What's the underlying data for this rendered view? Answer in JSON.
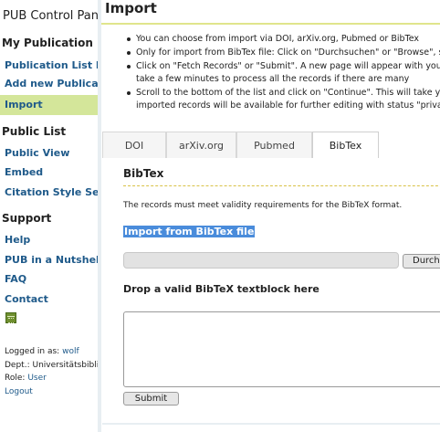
{
  "app": {
    "title": "PUB Control Panel"
  },
  "sidebar": {
    "section_my": "My Publication List",
    "my_items": [
      {
        "label": "Publication List Management"
      },
      {
        "label": "Add new Publication"
      },
      {
        "label": "Import",
        "active": true
      }
    ],
    "section_public": "Public List",
    "public_items": [
      {
        "label": "Public View"
      },
      {
        "label": "Embed"
      },
      {
        "label": "Citation Style Settings"
      }
    ],
    "section_support": "Support",
    "support_items": [
      {
        "label": "Help"
      },
      {
        "label": "PUB in a Nutshell"
      },
      {
        "label": "FAQ"
      },
      {
        "label": "Contact"
      }
    ],
    "calendar_icon": "calendar-icon",
    "user": {
      "logged_in_label": "Logged in as:",
      "logged_in_value": "wolf",
      "dept_label": "Dept.:",
      "dept_value": "Universitätsbibliothek",
      "role_label": "Role:",
      "role_value": "User",
      "logout": "Logout"
    }
  },
  "main": {
    "title": "Import",
    "bullets": [
      [
        "You can choose from import via DOI, arXiv.org, Pubmed or BibTex"
      ],
      [
        "Only for import from BibTex file: Click on \"Durchsuchen\" or \"Browse\", select your file"
      ],
      [
        "Click on \"Fetch Records\" or \"Submit\". A new page will appear with your records.",
        "take a few minutes to process all the records if there are many"
      ],
      [
        "Scroll to the bottom of the list and click on \"Continue\". This will take you to",
        "imported records will be available for further editing with status \"private\""
      ]
    ],
    "tabs": [
      "DOI",
      "arXiv.org",
      "Pubmed",
      "BibTex"
    ],
    "active_tab": "BibTex",
    "panel": {
      "title": "BibTex",
      "requirement_text": "The records must meet validity requirements for the BibTeX format.",
      "import_heading": "Import from BibTex file",
      "browse_label": "Durchsuchen...",
      "drop_heading": "Drop a valid BibTeX textblock here",
      "submit_label": "Submit"
    }
  },
  "colors": {
    "active_nav_bg": "#d4e69a",
    "link": "#1f5a8a",
    "title_rule": "#e0e58c",
    "selection": "#4a8cdb"
  }
}
